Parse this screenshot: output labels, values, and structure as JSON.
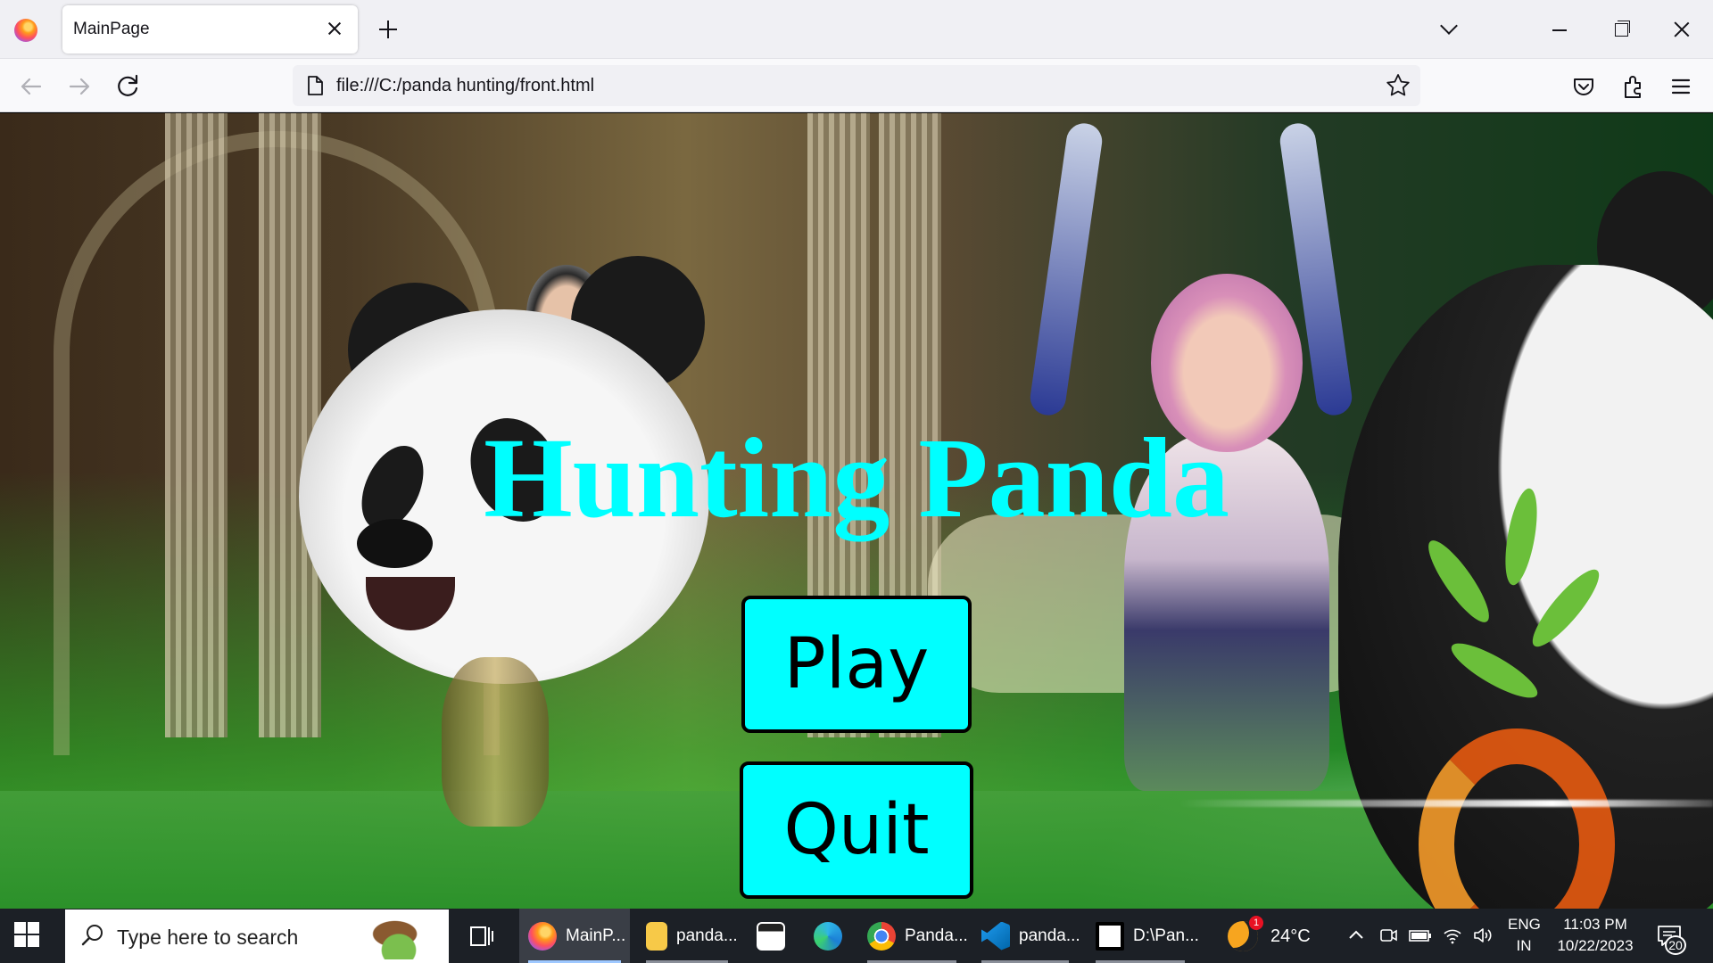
{
  "browser": {
    "tab_title": "MainPage",
    "url": "file:///C:/panda hunting/front.html"
  },
  "page": {
    "title": "Hunting Panda",
    "buttons": {
      "play": "Play",
      "quit": "Quit"
    },
    "title_color": "#00ffff",
    "button_color": "#00ffff"
  },
  "taskbar": {
    "search_placeholder": "Type here to search",
    "apps": [
      {
        "label": "MainP...",
        "icon": "firefox-icon",
        "active": true
      },
      {
        "label": "panda...",
        "icon": "folder-icon"
      },
      {
        "label": "",
        "icon": "clapper-icon"
      },
      {
        "label": "",
        "icon": "edge-icon"
      },
      {
        "label": "Panda...",
        "icon": "chrome-icon"
      },
      {
        "label": "panda...",
        "icon": "vscode-icon"
      },
      {
        "label": "D:\\Pan...",
        "icon": "7zip-icon"
      }
    ],
    "weather": {
      "temp": "24°C",
      "badge": "1"
    },
    "language": {
      "line1": "ENG",
      "line2": "IN"
    },
    "clock": {
      "time": "11:03 PM",
      "date": "10/22/2023"
    },
    "notifications": "20"
  }
}
